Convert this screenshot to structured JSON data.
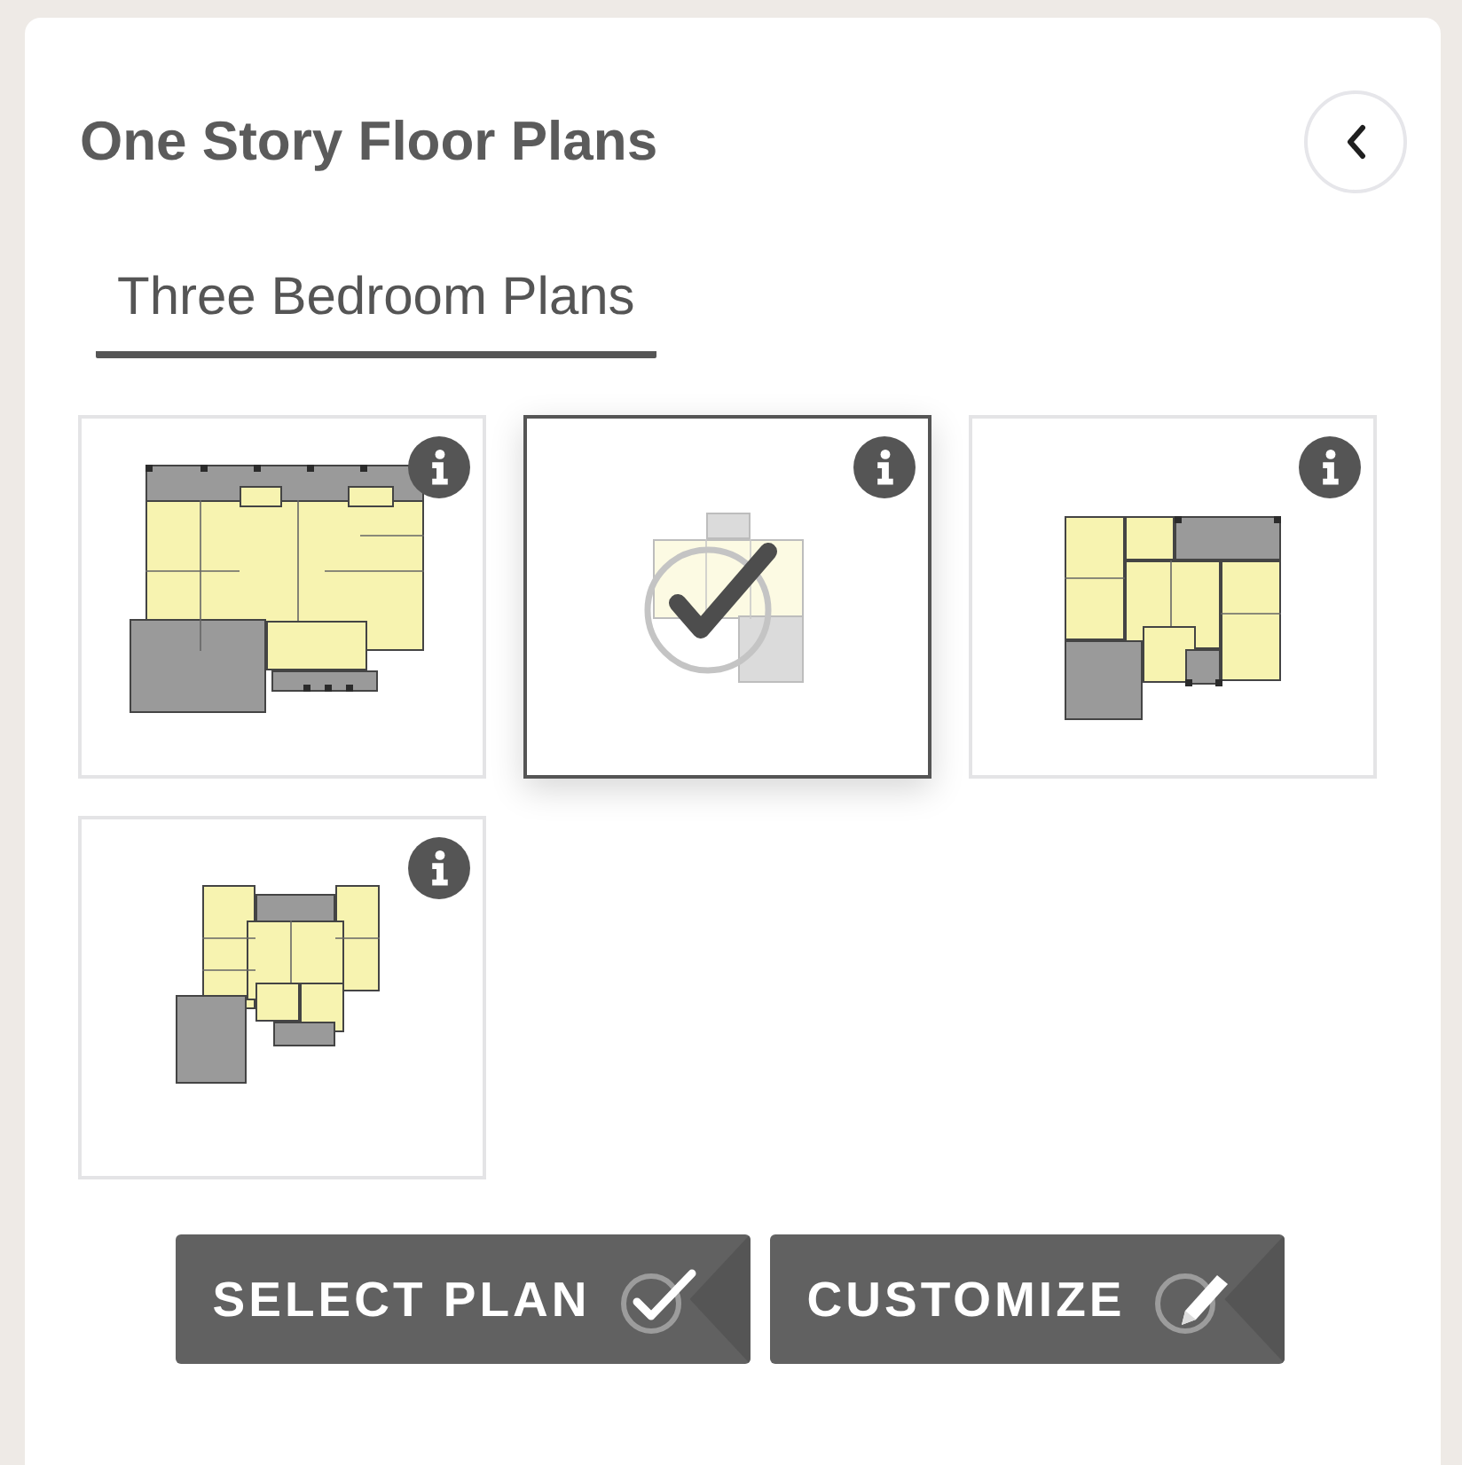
{
  "header": {
    "title": "One Story Floor Plans"
  },
  "tabs": [
    {
      "label": "Three Bedroom Plans",
      "selected": true
    }
  ],
  "plans": [
    {
      "selected": false
    },
    {
      "selected": true
    },
    {
      "selected": false
    },
    {
      "selected": false
    }
  ],
  "buttons": [
    {
      "label": "SELECT PLAN",
      "kind": "select"
    },
    {
      "label": "CUSTOMIZE",
      "kind": "customize"
    }
  ]
}
